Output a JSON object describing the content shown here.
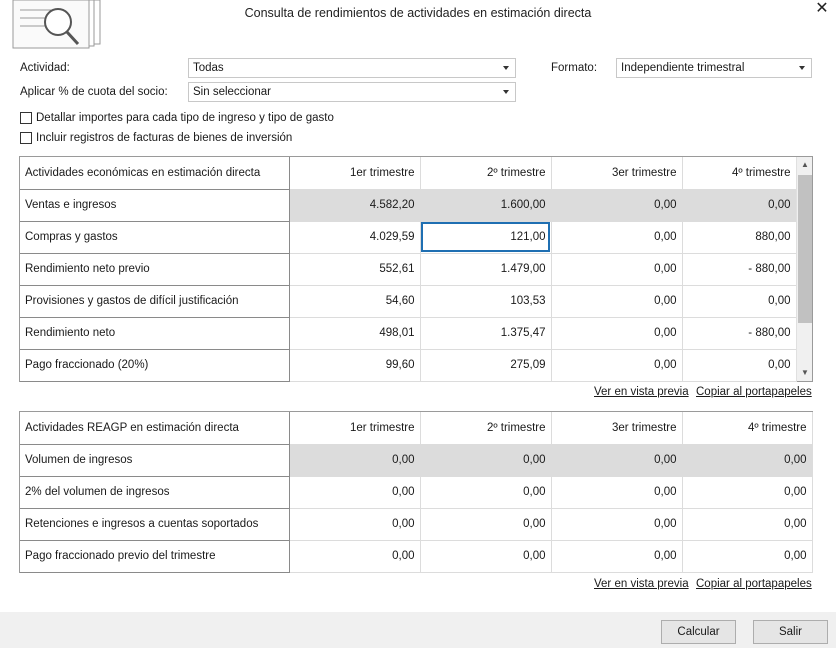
{
  "window": {
    "title": "Consulta de rendimientos de actividades en estimación directa"
  },
  "form": {
    "actividad_label": "Actividad:",
    "actividad_value": "Todas",
    "formato_label": "Formato:",
    "formato_value": "Independiente trimestral",
    "cuota_label": "Aplicar % de cuota del socio:",
    "cuota_value": "Sin seleccionar",
    "check_detallar": "Detallar importes para cada tipo de ingreso y tipo de gasto",
    "check_incluir": "Incluir registros de facturas de bienes de inversión"
  },
  "table1": {
    "headers": [
      "Actividades económicas en estimación directa",
      "1er trimestre",
      "2º trimestre",
      "3er trimestre",
      "4º trimestre"
    ],
    "rows": [
      {
        "label": "Ventas e ingresos",
        "values": [
          "4.582,20",
          "1.600,00",
          "0,00",
          "0,00"
        ]
      },
      {
        "label": "Compras y gastos",
        "values": [
          "4.029,59",
          "121,00",
          "0,00",
          "880,00"
        ]
      },
      {
        "label": "Rendimiento neto previo",
        "values": [
          "552,61",
          "1.479,00",
          "0,00",
          "- 880,00"
        ]
      },
      {
        "label": "Provisiones y gastos de difícil justificación",
        "values": [
          "54,60",
          "103,53",
          "0,00",
          "0,00"
        ]
      },
      {
        "label": "Rendimiento neto",
        "values": [
          "498,01",
          "1.375,47",
          "0,00",
          "- 880,00"
        ]
      },
      {
        "label": "Pago fraccionado (20%)",
        "values": [
          "99,60",
          "275,09",
          "0,00",
          "0,00"
        ]
      }
    ]
  },
  "table2": {
    "headers": [
      "Actividades REAGP en estimación directa",
      "1er trimestre",
      "2º trimestre",
      "3er trimestre",
      "4º trimestre"
    ],
    "rows": [
      {
        "label": "Volumen de ingresos",
        "values": [
          "0,00",
          "0,00",
          "0,00",
          "0,00"
        ]
      },
      {
        "label": "2% del volumen de ingresos",
        "values": [
          "0,00",
          "0,00",
          "0,00",
          "0,00"
        ]
      },
      {
        "label": "Retenciones e ingresos a cuentas soportados",
        "values": [
          "0,00",
          "0,00",
          "0,00",
          "0,00"
        ]
      },
      {
        "label": "Pago fraccionado previo del trimestre",
        "values": [
          "0,00",
          "0,00",
          "0,00",
          "0,00"
        ]
      }
    ]
  },
  "links": {
    "preview": "Ver en vista previa",
    "clipboard": "Copiar al portapapeles"
  },
  "buttons": {
    "calcular": "Calcular",
    "salir": "Salir"
  },
  "icons": {
    "close": "close-icon",
    "logo": "document-search-icon"
  }
}
